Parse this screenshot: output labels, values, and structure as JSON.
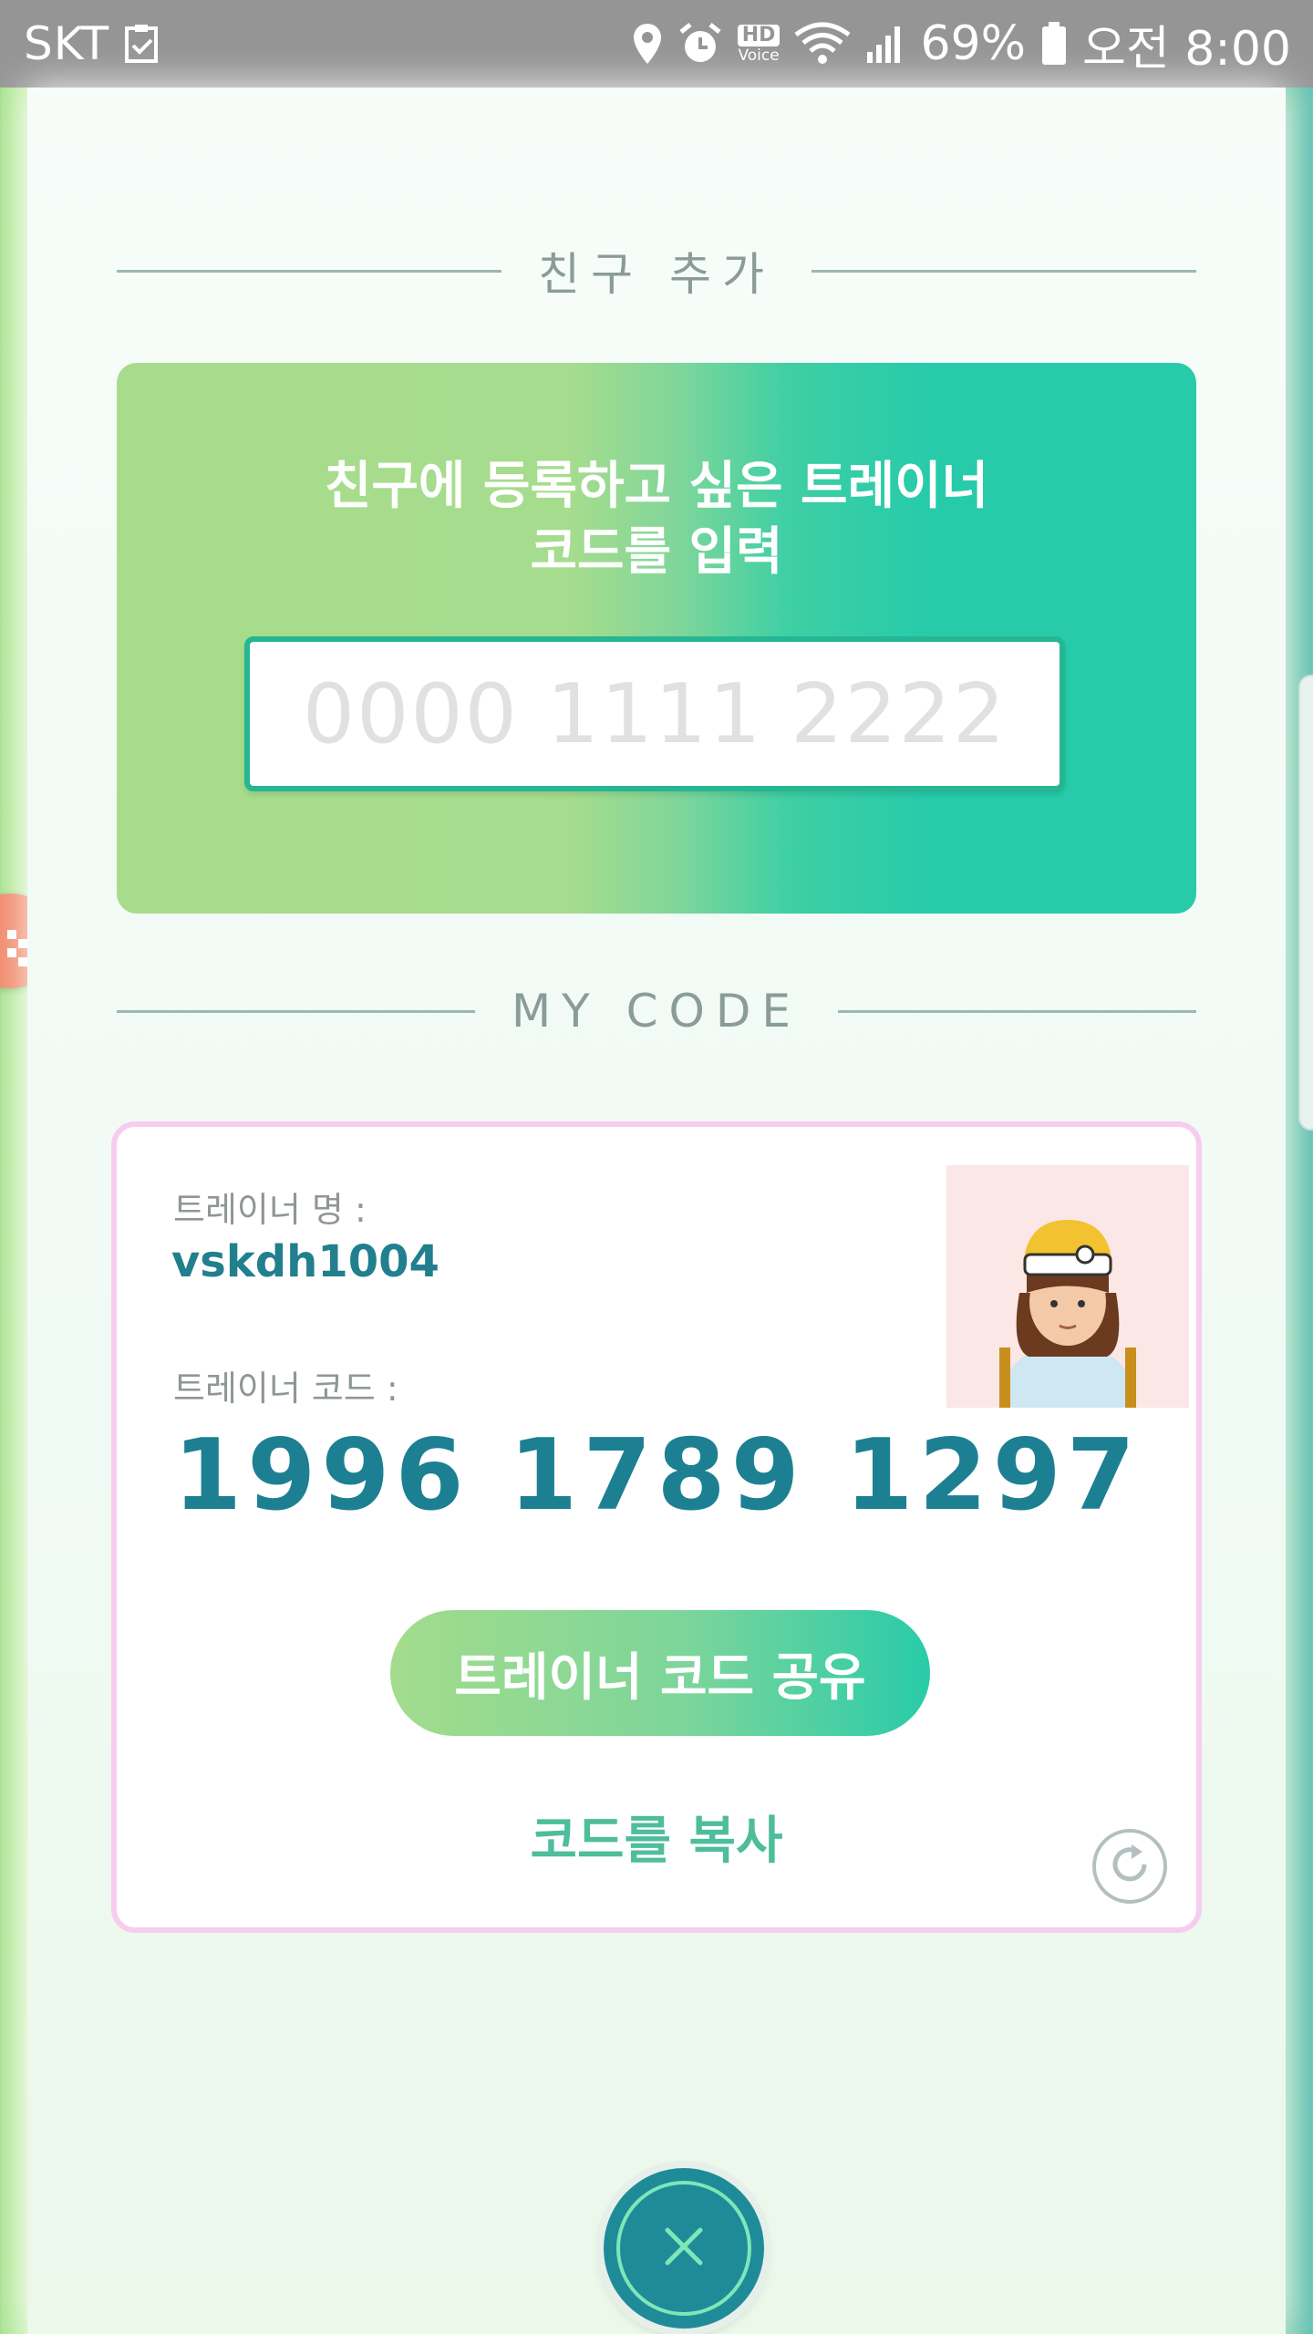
{
  "status_bar": {
    "carrier": "SKT",
    "hd_label": "HD",
    "voice_label": "Voice",
    "battery": "69%",
    "time": "오전 8:00"
  },
  "add_friend": {
    "header": "친구 추가",
    "prompt_line1": "친구에 등록하고 싶은 트레이너",
    "prompt_line2": "코드를 입력",
    "input_placeholder": "0000 1111 2222",
    "input_value": ""
  },
  "my_code": {
    "header": "MY CODE",
    "name_label": "트레이너 명 :",
    "trainer_name": "vskdh1004",
    "code_label": "트레이너 코드 :",
    "trainer_code": "1996 1789 1297",
    "share_button": "트레이너 코드 공유",
    "copy_link": "코드를 복사"
  },
  "icons": {
    "close": "close-icon",
    "refresh": "refresh-icon",
    "location": "location-icon",
    "alarm": "alarm-icon",
    "wifi": "wifi-icon",
    "signal": "signal-icon",
    "battery": "battery-icon",
    "checkbox": "checklist-icon"
  },
  "colors": {
    "accent": "#27cbaa",
    "accent_light": "#a8dc8d",
    "code_text": "#1d8092",
    "card_border": "#f7cdee"
  }
}
